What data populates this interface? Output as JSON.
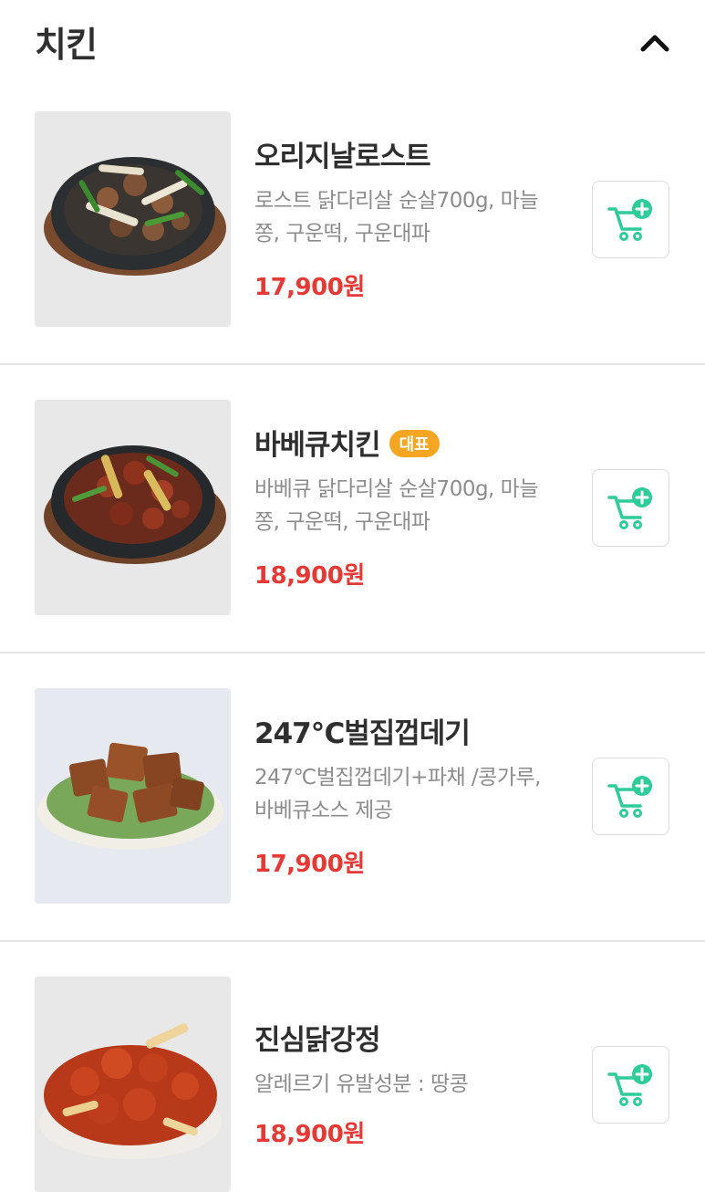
{
  "section": {
    "title": "치킨"
  },
  "items": [
    {
      "name": "오리지날로스트",
      "badge": "",
      "desc": "로스트 닭다리살 순살700g, 마늘쫑, 구운떡, 구운대파",
      "price": "17,900원"
    },
    {
      "name": "바베큐치킨",
      "badge": "대표",
      "desc": "바베큐 닭다리살 순살700g, 마늘쫑, 구운떡, 구운대파",
      "price": "18,900원"
    },
    {
      "name": "247℃벌집껍데기",
      "badge": "",
      "desc": "247℃벌집껍데기+파채 /콩가루, 바베큐소스 제공",
      "price": "17,900원"
    },
    {
      "name": "진심닭강정",
      "badge": "",
      "desc": "알레르기 유발성분 : 땅콩",
      "price": "18,900원"
    }
  ],
  "icons": {
    "collapse": "chevron-up-icon",
    "cart": "cart-plus-icon"
  },
  "colors": {
    "price": "#e53935",
    "cart_accent": "#2ecc9a",
    "badge": "#f6a623"
  }
}
